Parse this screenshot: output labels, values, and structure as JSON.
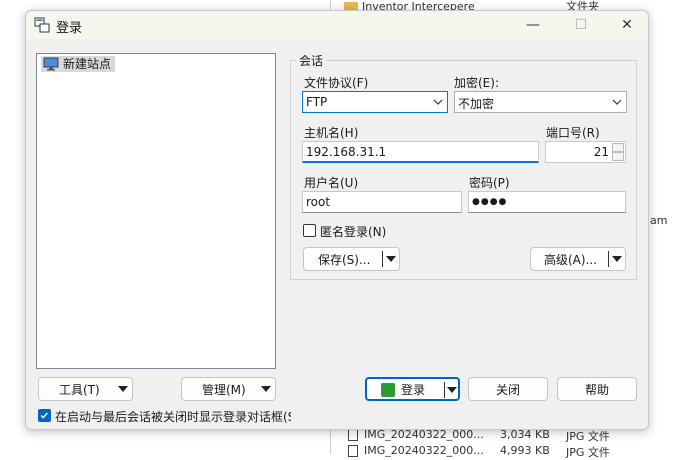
{
  "background": {
    "top_row_text": "Inventor Intercepere",
    "top_row_type": "文件夹",
    "side_text": "am",
    "rows": [
      {
        "name": "IMG_20240322_000...",
        "size": "3,034 KB",
        "type": "JPG 文件"
      },
      {
        "name": "IMG_20240322_000...",
        "size": "4,993 KB",
        "type": "JPG 文件"
      }
    ]
  },
  "dialog": {
    "title": "登录",
    "app_icon": "winscp-icon",
    "window_controls": {
      "minimize": "—",
      "maximize": "☐",
      "close": "✕"
    },
    "site_list": {
      "items": [
        {
          "label": "新建站点",
          "icon": "monitor-icon",
          "selected": true
        }
      ]
    },
    "session": {
      "title": "会话",
      "protocol_label": "文件协议(F)",
      "protocol_value": "FTP",
      "encryption_label": "加密(E):",
      "encryption_value": "不加密",
      "host_label": "主机名(H)",
      "host_value": "192.168.31.1",
      "port_label": "端口号(R)",
      "port_value": "21",
      "user_label": "用户名(U)",
      "user_value": "root",
      "password_label": "密码(P)",
      "password_mask": "●●●●",
      "anonymous_label": "匿名登录(N)",
      "anonymous_checked": false,
      "save_label": "保存(S)...",
      "advanced_label": "高级(A)..."
    },
    "buttons": {
      "tools": "工具(T)",
      "manage": "管理(M)",
      "login": "登录",
      "close": "关闭",
      "help": "帮助"
    },
    "show_on_startup_label": "在启动与最后会话被关闭时显示登录对话框(S",
    "show_on_startup_checked": true
  },
  "colors": {
    "accent": "#0067c0",
    "focus": "#0078d7",
    "login_icon": "#2e9a35"
  }
}
